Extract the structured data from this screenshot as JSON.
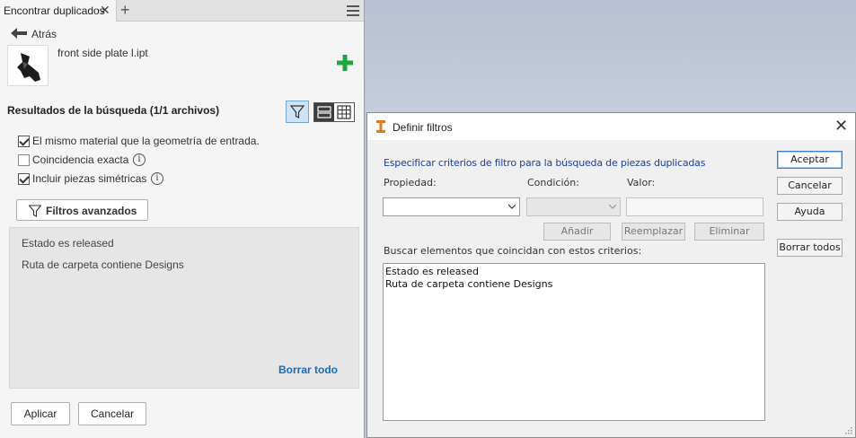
{
  "panel": {
    "tab_title": "Encontrar duplicados",
    "tab_close": "✕",
    "tab_add": "+",
    "back_label": "Atrás",
    "file_name": "front side plate l.ipt",
    "results_title": "Resultados de la búsqueda (1/1 archivos)",
    "options": [
      {
        "label": "El mismo material que la geometría de entrada.",
        "checked": true
      },
      {
        "label": "Coincidencia exacta",
        "checked": false
      },
      {
        "label": "Incluir piezas simétricas",
        "checked": true
      }
    ],
    "info_glyph": "i",
    "advanced_filters_label": "Filtros avanzados",
    "filters": [
      "Estado es released",
      "Ruta de carpeta contiene Designs"
    ],
    "clear_all_label": "Borrar todo",
    "apply_label": "Aplicar",
    "cancel_label": "Cancelar",
    "colors": {
      "accent": "#1b6ab4",
      "plus": "#1ea640"
    }
  },
  "dialog": {
    "title": "Definir filtros",
    "close": "✕",
    "description": "Especificar criterios de filtro para la búsqueda de piezas duplicadas",
    "property_label": "Propiedad:",
    "condition_label": "Condición:",
    "value_label": "Valor:",
    "property_value": "",
    "condition_value": "",
    "value_input": "",
    "add_label": "Añadir",
    "replace_label": "Reemplazar",
    "delete_label": "Eliminar",
    "match_label": "Buscar elementos que coincidan con estos criterios:",
    "criteria": [
      "Estado es released",
      "Ruta de carpeta contiene Designs"
    ],
    "accept_label": "Aceptar",
    "cancel_label": "Cancelar",
    "help_label": "Ayuda",
    "clear_all_label": "Borrar todos"
  }
}
